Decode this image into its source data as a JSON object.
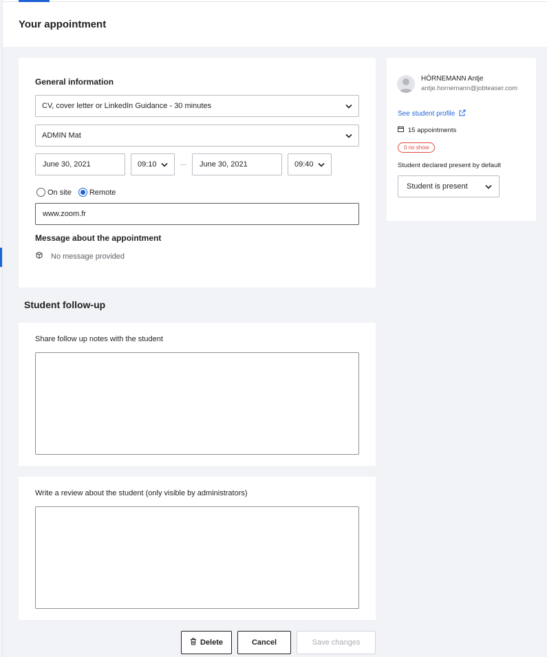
{
  "page": {
    "title": "Your appointment"
  },
  "general": {
    "heading": "General information",
    "service": "CV, cover letter or LinkedIn Guidance - 30 minutes",
    "advisor": "ADMIN Mat",
    "start_date": "June 30, 2021",
    "start_time": "09:10",
    "end_date": "June 30, 2021",
    "end_time": "09:40",
    "location_options": [
      {
        "label": "On site",
        "selected": false
      },
      {
        "label": "Remote",
        "selected": true
      }
    ],
    "location_value": "www.zoom.fr",
    "message_heading": "Message about the appointment",
    "message_text": "No message provided"
  },
  "followup": {
    "heading": "Student follow-up",
    "notes_label": "Share follow up notes with the student",
    "notes_value": "",
    "review_label": "Write a review about the student (only visible by administrators)",
    "review_value": ""
  },
  "student": {
    "name": "HÖRNEMANN Antje",
    "email": "antje.hornemann@jobteaser.com",
    "profile_link": "See student profile",
    "appointments": "15 appointments",
    "no_show_badge": "0 no show",
    "presence_label": "Student declared present by default",
    "presence_value": "Student is present"
  },
  "actions": {
    "delete": "Delete",
    "cancel": "Cancel",
    "save": "Save changes"
  },
  "colors": {
    "accent": "#1d63d6",
    "danger": "#e0483e",
    "background": "#f2f3f6"
  }
}
